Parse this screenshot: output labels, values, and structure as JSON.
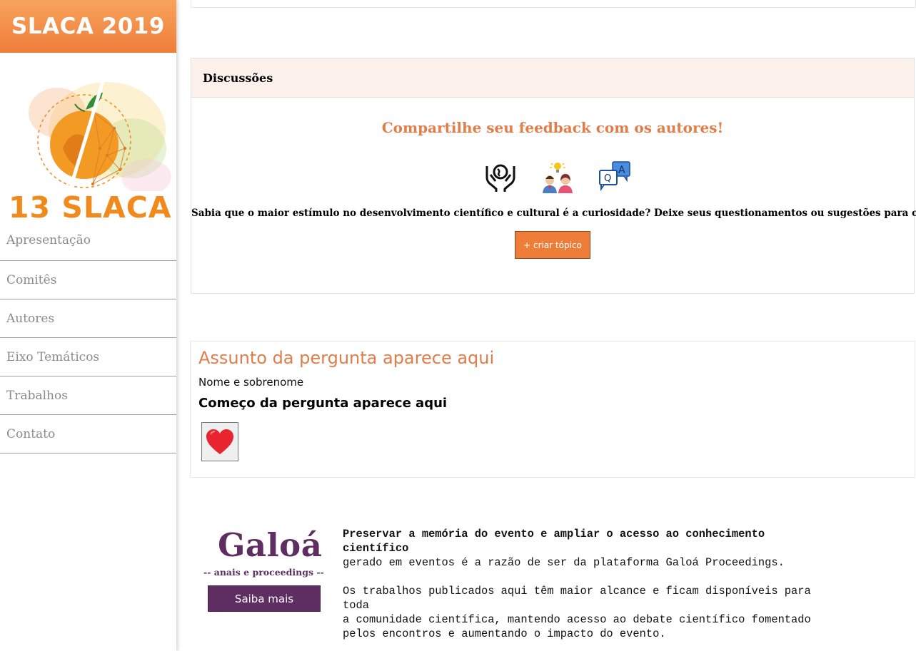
{
  "sidebar": {
    "brand": "SLACA 2019",
    "logo_text": "13 SLACA",
    "nav": [
      {
        "label": "Apresentação"
      },
      {
        "label": "Comitês"
      },
      {
        "label": "Autores"
      },
      {
        "label": "Eixo Temáticos"
      },
      {
        "label": "Trabalhos"
      },
      {
        "label": "Contato"
      }
    ]
  },
  "discussions": {
    "title": "Discussões",
    "cta": "Compartilhe seu feedback com os autores!",
    "icons": [
      "helping-hands-globe-icon",
      "people-idea-icon",
      "qa-chat-icon"
    ],
    "text": "Sabia que o maior estímulo no desenvolvimento científico e cultural é a curiosidade? Deixe seus questionamentos ou sugestões para o autor",
    "create_topic_label": "+ criar tópico"
  },
  "question": {
    "subject": "Assunto da pergunta aparece aqui",
    "author": "Nome e sobrenome",
    "start": "Começo da pergunta aparece aqui",
    "like_icon": "heart-icon"
  },
  "footer": {
    "brand": "Galoá",
    "tagline": "-- anais e proceedings --",
    "more_label": "Saiba mais",
    "lead_line1": "Preservar a memória do evento e ampliar o acesso ao conhecimento",
    "lead_line2": "científico",
    "line3": "gerado em eventos é a razão de ser da plataforma Galoá Proceedings.",
    "line4": "Os trabalhos publicados aqui têm maior alcance e ficam disponíveis para",
    "line5": "toda",
    "line6": "a comunidade científica, mantendo acesso ao debate científico fomentado",
    "line7": "pelos encontros e aumentando o impacto do evento."
  },
  "colors": {
    "accent_orange": "#ef7d3a",
    "heading_orange": "#e07d48",
    "galoa_purple": "#5e2d61",
    "header_tint": "#fcf0ea"
  }
}
